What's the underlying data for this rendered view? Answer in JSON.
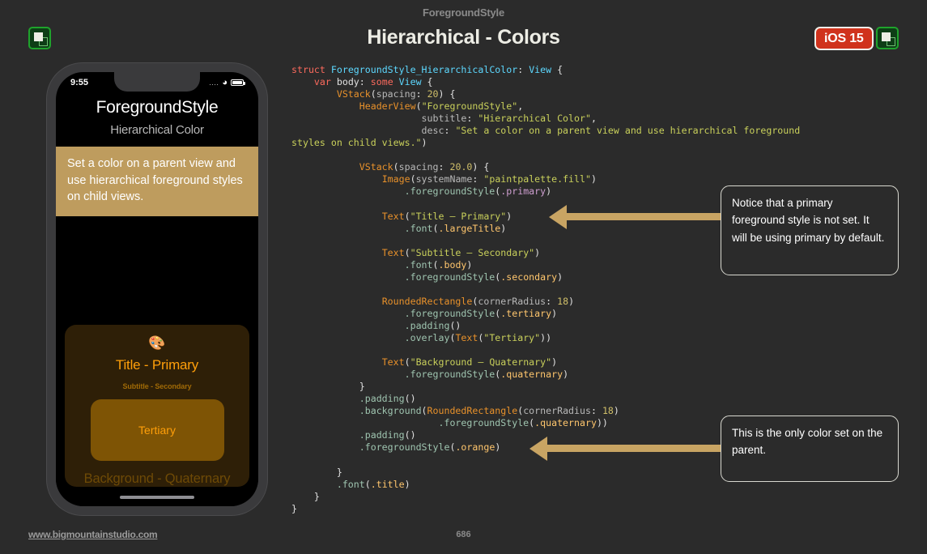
{
  "header": {
    "eyebrow": "ForegroundStyle",
    "title": "Hierarchical - Colors",
    "ios_badge": "iOS 15",
    "badge_color": "#D0321C",
    "app_icon_name": "swiftui-app-icon"
  },
  "phone": {
    "status": {
      "time": "9:55",
      "signal": "....",
      "wifi": "wifi-icon",
      "battery": "battery-icon"
    },
    "app_title": "ForegroundStyle",
    "app_subtitle": "Hierarchical Color",
    "description": "Set a color on a parent view and use hierarchical foreground styles on child views.",
    "description_bg": "#BE9C5E",
    "demo": {
      "icon": "🎨",
      "icon_name": "paintpalette-fill-icon",
      "title": "Title - Primary",
      "subtitle": "Subtitle - Secondary",
      "tertiary": "Tertiary",
      "quaternary": "Background - Quaternary",
      "accent_color": "#FF9F0A",
      "card_bg": "#2E1F07",
      "tertiary_bg": "#7E5405"
    }
  },
  "code": {
    "lines": [
      [
        {
          "t": "struct ",
          "c": "kw"
        },
        {
          "t": "ForegroundStyle_HierarchicalColor",
          "c": "ty"
        },
        {
          "t": ": ",
          "c": "pl"
        },
        {
          "t": "View",
          "c": "ty"
        },
        {
          "t": " {",
          "c": "pl"
        }
      ],
      [
        {
          "t": "    ",
          "c": "pl"
        },
        {
          "t": "var",
          "c": "kw"
        },
        {
          "t": " body",
          "c": "pl"
        },
        {
          "t": ": ",
          "c": "pl"
        },
        {
          "t": "some",
          "c": "kw"
        },
        {
          "t": " ",
          "c": "pl"
        },
        {
          "t": "View",
          "c": "ty"
        },
        {
          "t": " {",
          "c": "pl"
        }
      ],
      [
        {
          "t": "        ",
          "c": "pl"
        },
        {
          "t": "VStack",
          "c": "fn"
        },
        {
          "t": "(",
          "c": "pl"
        },
        {
          "t": "spacing",
          "c": "lbl"
        },
        {
          "t": ": ",
          "c": "pl"
        },
        {
          "t": "20",
          "c": "num"
        },
        {
          "t": ") {",
          "c": "pl"
        }
      ],
      [
        {
          "t": "            ",
          "c": "pl"
        },
        {
          "t": "HeaderView",
          "c": "fn"
        },
        {
          "t": "(",
          "c": "pl"
        },
        {
          "t": "\"ForegroundStyle\"",
          "c": "st"
        },
        {
          "t": ",",
          "c": "pl"
        }
      ],
      [
        {
          "t": "                       ",
          "c": "pl"
        },
        {
          "t": "subtitle",
          "c": "lbl"
        },
        {
          "t": ": ",
          "c": "pl"
        },
        {
          "t": "\"Hierarchical Color\"",
          "c": "st"
        },
        {
          "t": ",",
          "c": "pl"
        }
      ],
      [
        {
          "t": "                       ",
          "c": "pl"
        },
        {
          "t": "desc",
          "c": "lbl"
        },
        {
          "t": ": ",
          "c": "pl"
        },
        {
          "t": "\"Set a color on a parent view and use hierarchical foreground",
          "c": "st"
        }
      ],
      [
        {
          "t": "styles on child views.\"",
          "c": "st"
        },
        {
          "t": ")",
          "c": "pl"
        }
      ],
      [
        {
          "t": "",
          "c": "pl"
        }
      ],
      [
        {
          "t": "            ",
          "c": "pl"
        },
        {
          "t": "VStack",
          "c": "fn"
        },
        {
          "t": "(",
          "c": "pl"
        },
        {
          "t": "spacing",
          "c": "lbl"
        },
        {
          "t": ": ",
          "c": "pl"
        },
        {
          "t": "20.0",
          "c": "num"
        },
        {
          "t": ") {",
          "c": "pl"
        }
      ],
      [
        {
          "t": "                ",
          "c": "pl"
        },
        {
          "t": "Image",
          "c": "fn"
        },
        {
          "t": "(",
          "c": "pl"
        },
        {
          "t": "systemName",
          "c": "lbl"
        },
        {
          "t": ": ",
          "c": "pl"
        },
        {
          "t": "\"paintpalette.fill\"",
          "c": "st"
        },
        {
          "t": ")",
          "c": "pl"
        }
      ],
      [
        {
          "t": "                    ",
          "c": "pl"
        },
        {
          "t": ".foregroundStyle",
          "c": "at"
        },
        {
          "t": "(",
          "c": "pl"
        },
        {
          "t": ".primary",
          "c": "pm"
        },
        {
          "t": ")",
          "c": "pl"
        }
      ],
      [
        {
          "t": "",
          "c": "pl"
        }
      ],
      [
        {
          "t": "                ",
          "c": "pl"
        },
        {
          "t": "Text",
          "c": "fn"
        },
        {
          "t": "(",
          "c": "pl"
        },
        {
          "t": "\"Title – Primary\"",
          "c": "st"
        },
        {
          "t": ")",
          "c": "pl"
        }
      ],
      [
        {
          "t": "                    ",
          "c": "pl"
        },
        {
          "t": ".font",
          "c": "at"
        },
        {
          "t": "(",
          "c": "pl"
        },
        {
          "t": ".largeTitle",
          "c": "md"
        },
        {
          "t": ")",
          "c": "pl"
        }
      ],
      [
        {
          "t": "",
          "c": "pl"
        }
      ],
      [
        {
          "t": "                ",
          "c": "pl"
        },
        {
          "t": "Text",
          "c": "fn"
        },
        {
          "t": "(",
          "c": "pl"
        },
        {
          "t": "\"Subtitle – Secondary\"",
          "c": "st"
        },
        {
          "t": ")",
          "c": "pl"
        }
      ],
      [
        {
          "t": "                    ",
          "c": "pl"
        },
        {
          "t": ".font",
          "c": "at"
        },
        {
          "t": "(",
          "c": "pl"
        },
        {
          "t": ".body",
          "c": "md"
        },
        {
          "t": ")",
          "c": "pl"
        }
      ],
      [
        {
          "t": "                    ",
          "c": "pl"
        },
        {
          "t": ".foregroundStyle",
          "c": "at"
        },
        {
          "t": "(",
          "c": "pl"
        },
        {
          "t": ".secondary",
          "c": "md"
        },
        {
          "t": ")",
          "c": "pl"
        }
      ],
      [
        {
          "t": "",
          "c": "pl"
        }
      ],
      [
        {
          "t": "                ",
          "c": "pl"
        },
        {
          "t": "RoundedRectangle",
          "c": "fn"
        },
        {
          "t": "(",
          "c": "pl"
        },
        {
          "t": "cornerRadius",
          "c": "lbl"
        },
        {
          "t": ": ",
          "c": "pl"
        },
        {
          "t": "18",
          "c": "num"
        },
        {
          "t": ")",
          "c": "pl"
        }
      ],
      [
        {
          "t": "                    ",
          "c": "pl"
        },
        {
          "t": ".foregroundStyle",
          "c": "at"
        },
        {
          "t": "(",
          "c": "pl"
        },
        {
          "t": ".tertiary",
          "c": "md"
        },
        {
          "t": ")",
          "c": "pl"
        }
      ],
      [
        {
          "t": "                    ",
          "c": "pl"
        },
        {
          "t": ".padding",
          "c": "at"
        },
        {
          "t": "()",
          "c": "pl"
        }
      ],
      [
        {
          "t": "                    ",
          "c": "pl"
        },
        {
          "t": ".overlay",
          "c": "at"
        },
        {
          "t": "(",
          "c": "pl"
        },
        {
          "t": "Text",
          "c": "fn"
        },
        {
          "t": "(",
          "c": "pl"
        },
        {
          "t": "\"Tertiary\"",
          "c": "st"
        },
        {
          "t": "))",
          "c": "pl"
        }
      ],
      [
        {
          "t": "",
          "c": "pl"
        }
      ],
      [
        {
          "t": "                ",
          "c": "pl"
        },
        {
          "t": "Text",
          "c": "fn"
        },
        {
          "t": "(",
          "c": "pl"
        },
        {
          "t": "\"Background – Quaternary\"",
          "c": "st"
        },
        {
          "t": ")",
          "c": "pl"
        }
      ],
      [
        {
          "t": "                    ",
          "c": "pl"
        },
        {
          "t": ".foregroundStyle",
          "c": "at"
        },
        {
          "t": "(",
          "c": "pl"
        },
        {
          "t": ".quaternary",
          "c": "md"
        },
        {
          "t": ")",
          "c": "pl"
        }
      ],
      [
        {
          "t": "            ",
          "c": "pl"
        },
        {
          "t": "}",
          "c": "pl"
        }
      ],
      [
        {
          "t": "            ",
          "c": "pl"
        },
        {
          "t": ".padding",
          "c": "at"
        },
        {
          "t": "()",
          "c": "pl"
        }
      ],
      [
        {
          "t": "            ",
          "c": "pl"
        },
        {
          "t": ".background",
          "c": "at"
        },
        {
          "t": "(",
          "c": "pl"
        },
        {
          "t": "RoundedRectangle",
          "c": "fn"
        },
        {
          "t": "(",
          "c": "pl"
        },
        {
          "t": "cornerRadius",
          "c": "lbl"
        },
        {
          "t": ": ",
          "c": "pl"
        },
        {
          "t": "18",
          "c": "num"
        },
        {
          "t": ")",
          "c": "pl"
        }
      ],
      [
        {
          "t": "                          ",
          "c": "pl"
        },
        {
          "t": ".foregroundStyle",
          "c": "at"
        },
        {
          "t": "(",
          "c": "pl"
        },
        {
          "t": ".quaternary",
          "c": "md"
        },
        {
          "t": "))",
          "c": "pl"
        }
      ],
      [
        {
          "t": "            ",
          "c": "pl"
        },
        {
          "t": ".padding",
          "c": "at"
        },
        {
          "t": "()",
          "c": "pl"
        }
      ],
      [
        {
          "t": "            ",
          "c": "pl"
        },
        {
          "t": ".foregroundStyle",
          "c": "at"
        },
        {
          "t": "(",
          "c": "pl"
        },
        {
          "t": ".orange",
          "c": "md"
        },
        {
          "t": ")",
          "c": "pl"
        }
      ],
      [
        {
          "t": "",
          "c": "pl"
        }
      ],
      [
        {
          "t": "        ",
          "c": "pl"
        },
        {
          "t": "}",
          "c": "pl"
        }
      ],
      [
        {
          "t": "        ",
          "c": "pl"
        },
        {
          "t": ".font",
          "c": "at"
        },
        {
          "t": "(",
          "c": "pl"
        },
        {
          "t": ".title",
          "c": "md"
        },
        {
          "t": ")",
          "c": "pl"
        }
      ],
      [
        {
          "t": "    ",
          "c": "pl"
        },
        {
          "t": "}",
          "c": "pl"
        }
      ],
      [
        {
          "t": "",
          "c": "pl"
        },
        {
          "t": "}",
          "c": "pl"
        }
      ]
    ]
  },
  "callouts": [
    {
      "text": "Notice that a primary foreground style is not set. It will be using primary by default."
    },
    {
      "text": "This is the only color set on the parent."
    }
  ],
  "arrow_color": "#C8A463",
  "footer": {
    "link": "www.bigmountainstudio.com",
    "page": "686"
  }
}
